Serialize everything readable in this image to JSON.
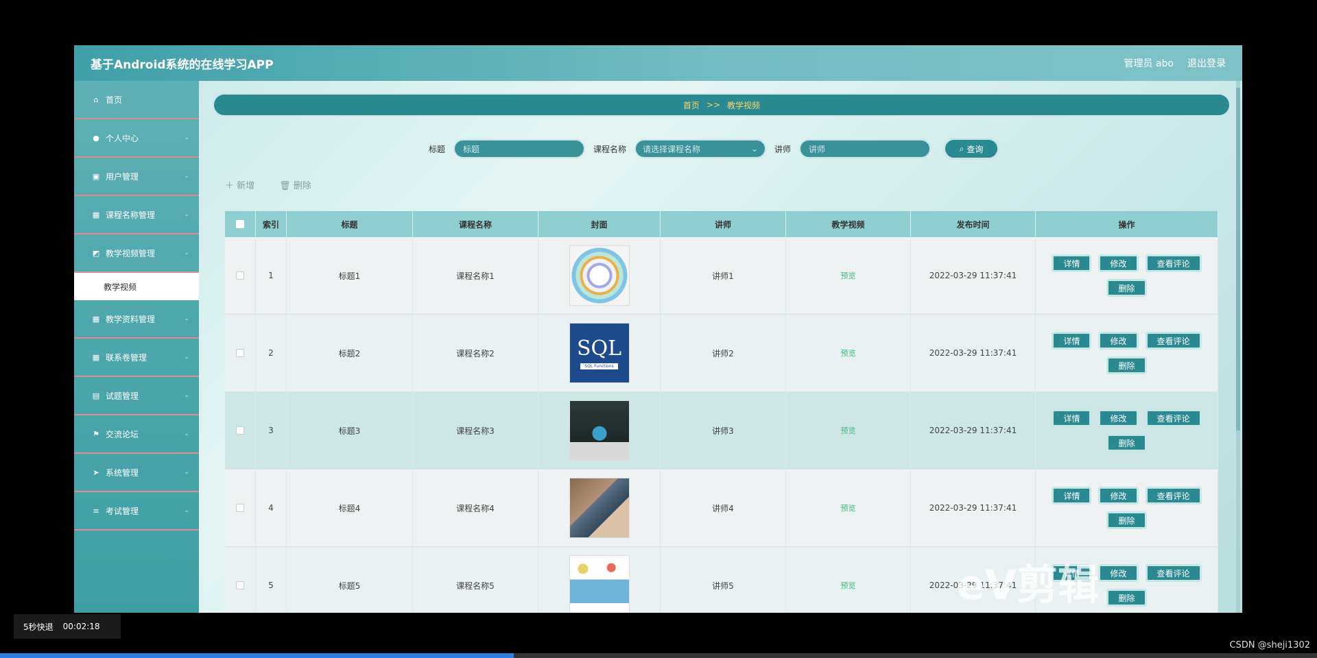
{
  "app": {
    "title": "基于Android系统的在线学习APP",
    "user": "管理员 abo",
    "logout": "退出登录"
  },
  "sidebar": {
    "items": [
      {
        "label": "首页",
        "icon": "home-icon",
        "glyph": "⌂",
        "chev": ""
      },
      {
        "label": "个人中心",
        "icon": "user-icon",
        "glyph": "●",
        "chev": "⌄"
      },
      {
        "label": "用户管理",
        "icon": "list-icon",
        "glyph": "▣",
        "chev": "⌄"
      },
      {
        "label": "课程名称管理",
        "icon": "grid-icon",
        "glyph": "▦",
        "chev": "⌄"
      },
      {
        "label": "教学视频管理",
        "icon": "folder-icon",
        "glyph": "◩",
        "chev": "⌄"
      }
    ],
    "sub_item": "教学视频",
    "items2": [
      {
        "label": "教学资料管理",
        "icon": "grid-icon",
        "glyph": "▦",
        "chev": "⌄"
      },
      {
        "label": "联系卷管理",
        "icon": "grid-icon",
        "glyph": "▦",
        "chev": "⌄"
      },
      {
        "label": "试题管理",
        "icon": "doc-icon",
        "glyph": "▤",
        "chev": "⌄"
      },
      {
        "label": "交流论坛",
        "icon": "flag-icon",
        "glyph": "⚑",
        "chev": "⌄"
      },
      {
        "label": "系统管理",
        "icon": "send-icon",
        "glyph": "➤",
        "chev": "⌄"
      },
      {
        "label": "考试管理",
        "icon": "menu-icon",
        "glyph": "≡",
        "chev": "⌄"
      }
    ]
  },
  "breadcrumb": {
    "home": "首页",
    "sep": ">>",
    "current": "教学视频"
  },
  "search": {
    "title_label": "标题",
    "title_placeholder": "标题",
    "course_label": "课程名称",
    "course_placeholder": "请选择课程名称",
    "teacher_label": "讲师",
    "teacher_placeholder": "讲师",
    "button": "查询"
  },
  "actions": {
    "add": "新增",
    "delete": "删除"
  },
  "table": {
    "headers": [
      "索引",
      "标题",
      "课程名称",
      "封面",
      "讲师",
      "教学视频",
      "发布时间",
      "操作"
    ],
    "rows": [
      {
        "index": "1",
        "title": "标题1",
        "course": "课程名称1",
        "teacher": "讲师1",
        "video": "预览",
        "time": "2022-03-29 11:37:41"
      },
      {
        "index": "2",
        "title": "标题2",
        "course": "课程名称2",
        "teacher": "讲师2",
        "video": "预览",
        "time": "2022-03-29 11:37:41"
      },
      {
        "index": "3",
        "title": "标题3",
        "course": "课程名称3",
        "teacher": "讲师3",
        "video": "预览",
        "time": "2022-03-29 11:37:41"
      },
      {
        "index": "4",
        "title": "标题4",
        "course": "课程名称4",
        "teacher": "讲师4",
        "video": "预览",
        "time": "2022-03-29 11:37:41"
      },
      {
        "index": "5",
        "title": "标题5",
        "course": "课程名称5",
        "teacher": "讲师5",
        "video": "预览",
        "time": "2022-03-29 11:37:41"
      }
    ],
    "ops": {
      "detail": "详情",
      "edit": "修改",
      "comments": "查看评论",
      "delete": "删除"
    },
    "sql_text": "SQL",
    "sql_tag": "SQL Functions"
  },
  "player": {
    "skip": "5秒快退",
    "time": "00:02:18"
  },
  "watermark": "CSDN @sheji1302",
  "overlay_logo": "eV剪辑",
  "colors": {
    "primary": "#2b8a91",
    "accent": "#f5d36a",
    "preview": "#3dbb7a"
  }
}
